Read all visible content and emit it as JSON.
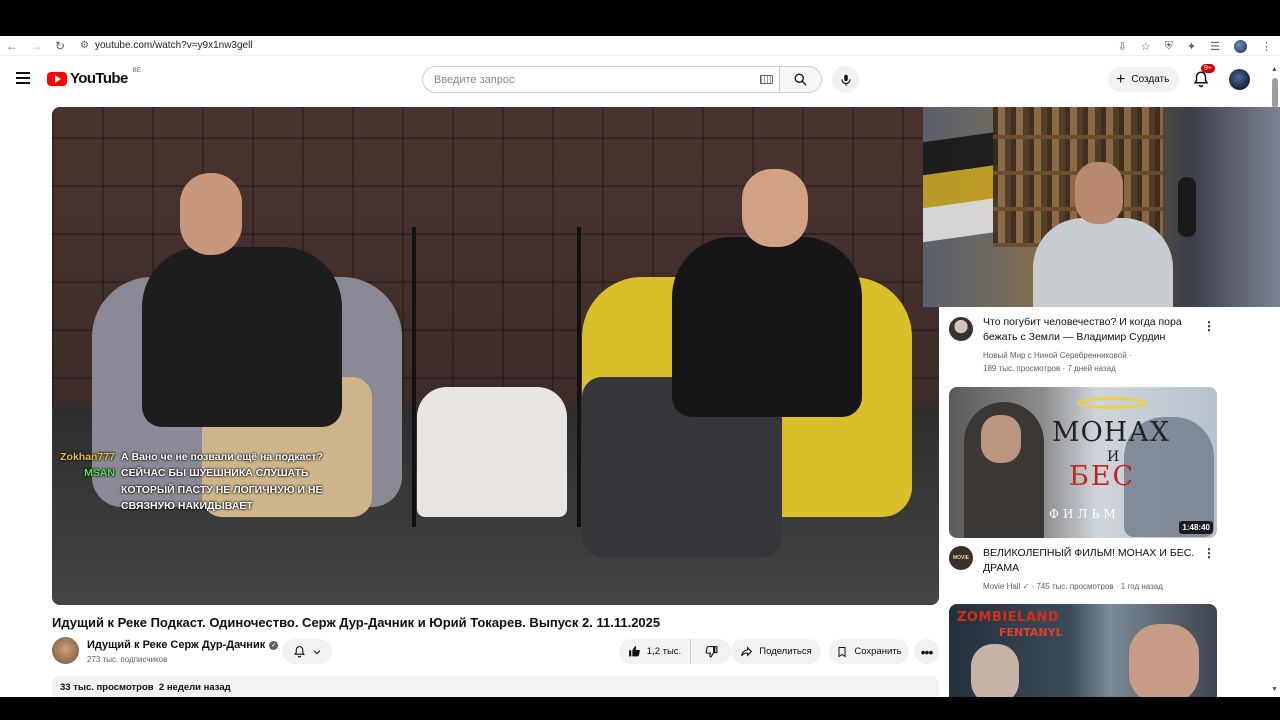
{
  "browser": {
    "url": "youtube.com/watch?v=y9x1nw3gell"
  },
  "header": {
    "logo_text": "YouTube",
    "country_code": "BE",
    "search_placeholder": "Введите запрос",
    "create_label": "Создать",
    "notifications_badge": "9+"
  },
  "video": {
    "title": "Идущий к Реке Подкаст. Одиночество. Серж Дур-Дачник и Юрий Токарев. Выпуск 2. 11.11.2025",
    "channel": "Идущий к Реке Серж Дур-Дачник",
    "subscribers": "273 тыс. подписчиков",
    "likes": "1,2 тыс.",
    "share_label": "Поделиться",
    "save_label": "Сохранить",
    "views": "33 тыс. просмотров",
    "published": "2 недели назад"
  },
  "chat": [
    {
      "user": "Zokhan777",
      "user_color": "#e8c33a",
      "message": "А Вано че не позвали ещё на подкаст?"
    },
    {
      "user": "MSAN",
      "user_color": "#58e05a",
      "message": "СЕЙЧАС БЫ ШУЕШНИКА СЛУШАТЬ КОТОРЫЙ ПАСТУ НЕ ЛОГИЧНУЮ И НЕ СВЯЗНУЮ НАКИДЫВАЕТ"
    }
  ],
  "recommendations": [
    {
      "title": "Что погубит человечество? И когда пора бежать с Земли — Владимир Сурдин",
      "channel": "Новый Мир с Ниной Серебренниковой",
      "views": "189 тыс. просмотров",
      "age": "7 дней назад"
    },
    {
      "title": "ВЕЛИКОЛЕПНЫЙ ФИЛЬМ! МОНАХ И БЕС. ДРАМА",
      "channel": "Movie Hall",
      "views": "745 тыс. просмотров",
      "age": "1 год назад",
      "duration": "1:48:40",
      "avatar_text": "MOVIE",
      "thumb_text": [
        "МОНАХ",
        "И",
        "БЕС",
        "ФИЛЬМ"
      ]
    },
    {
      "thumb_text": [
        "ZOMBIELAND",
        "FENTANYL"
      ]
    }
  ]
}
